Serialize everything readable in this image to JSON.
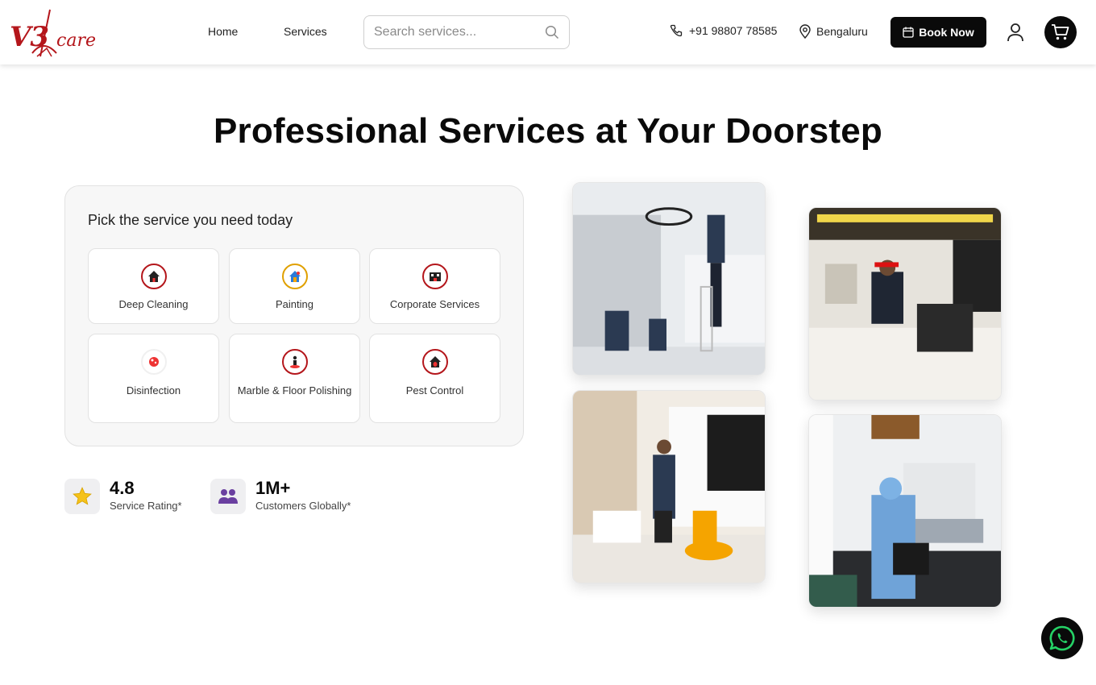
{
  "header": {
    "logo_text": "V3",
    "logo_sub": "care",
    "nav": [
      "Home",
      "Services"
    ],
    "search_placeholder": "Search services...",
    "phone": "+91 98807 78585",
    "location": "Bengaluru",
    "book_label": "Book Now"
  },
  "hero": {
    "title": "Professional Services at Your Doorstep"
  },
  "panel": {
    "title": "Pick the service you need today",
    "services": [
      {
        "label": "Deep Cleaning",
        "icon": "deep-cleaning-icon"
      },
      {
        "label": "Painting",
        "icon": "painting-icon"
      },
      {
        "label": "Corporate Services",
        "icon": "corporate-services-icon"
      },
      {
        "label": "Disinfection",
        "icon": "disinfection-icon"
      },
      {
        "label": "Marble & Floor Polishing",
        "icon": "floor-polishing-icon"
      },
      {
        "label": "Pest Control",
        "icon": "pest-control-icon"
      }
    ]
  },
  "stats": [
    {
      "value": "4.8",
      "label": "Service Rating*",
      "icon": "star-icon"
    },
    {
      "value": "1M+",
      "label": "Customers Globally*",
      "icon": "users-icon"
    }
  ],
  "colors": {
    "brand_red": "#b4161b",
    "black": "#0a0a0a",
    "panel_bg": "#f7f7f7",
    "whatsapp_green": "#25d366"
  }
}
